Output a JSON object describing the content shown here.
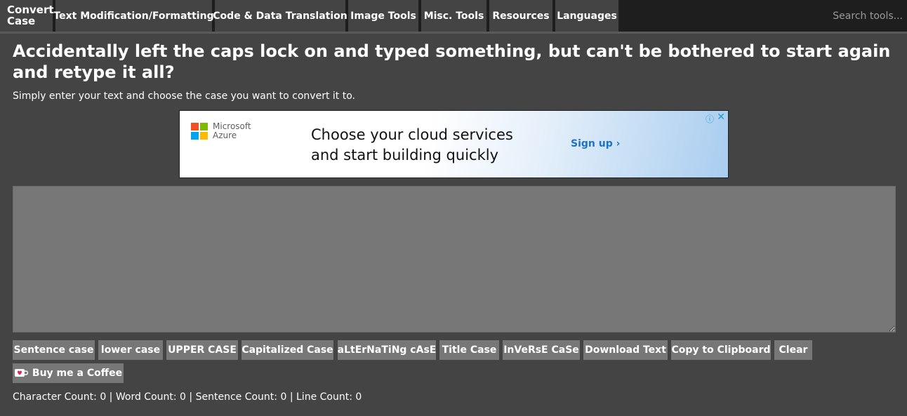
{
  "nav": {
    "logo": [
      "Convert",
      "Case"
    ],
    "items": [
      "Text Modification/Formatting",
      "Code & Data Translation",
      "Image Tools",
      "Misc. Tools",
      "Resources",
      "Languages"
    ],
    "search_placeholder": "Search tools..."
  },
  "headline": "Accidentally left the caps lock on and typed something, but can't be bothered to start again and retype it all?",
  "subtext": "Simply enter your text and choose the case you want to convert it to.",
  "ad": {
    "brand_line1": "Microsoft",
    "brand_line2": "Azure",
    "headline_line1": "Choose your cloud services",
    "headline_line2": "and start building quickly",
    "cta": "Sign up ›",
    "info_icon": "info-icon",
    "close_icon": "close-icon",
    "logo_colors": [
      "#f25022",
      "#7fba00",
      "#00a4ef",
      "#ffb900"
    ]
  },
  "editor": {
    "value": "",
    "placeholder": ""
  },
  "buttons": [
    "Sentence case",
    "lower case",
    "UPPER CASE",
    "Capitalized Case",
    "aLtErNaTiNg cAsE",
    "Title Case",
    "InVeRsE CaSe",
    "Download Text",
    "Copy to Clipboard",
    "Clear"
  ],
  "coffee_button": "Buy me a Coffee",
  "counts": {
    "character_label": "Character Count: ",
    "character": "0",
    "word_label": "Word Count: ",
    "word": "0",
    "sentence_label": "Sentence Count: ",
    "sentence": "0",
    "line_label": "Line Count: ",
    "line": "0",
    "separator": " | "
  },
  "colors": {
    "background": "#444444",
    "nav_background": "#1e1e1e",
    "button": "#777777",
    "ad_link": "#1a73c7"
  }
}
